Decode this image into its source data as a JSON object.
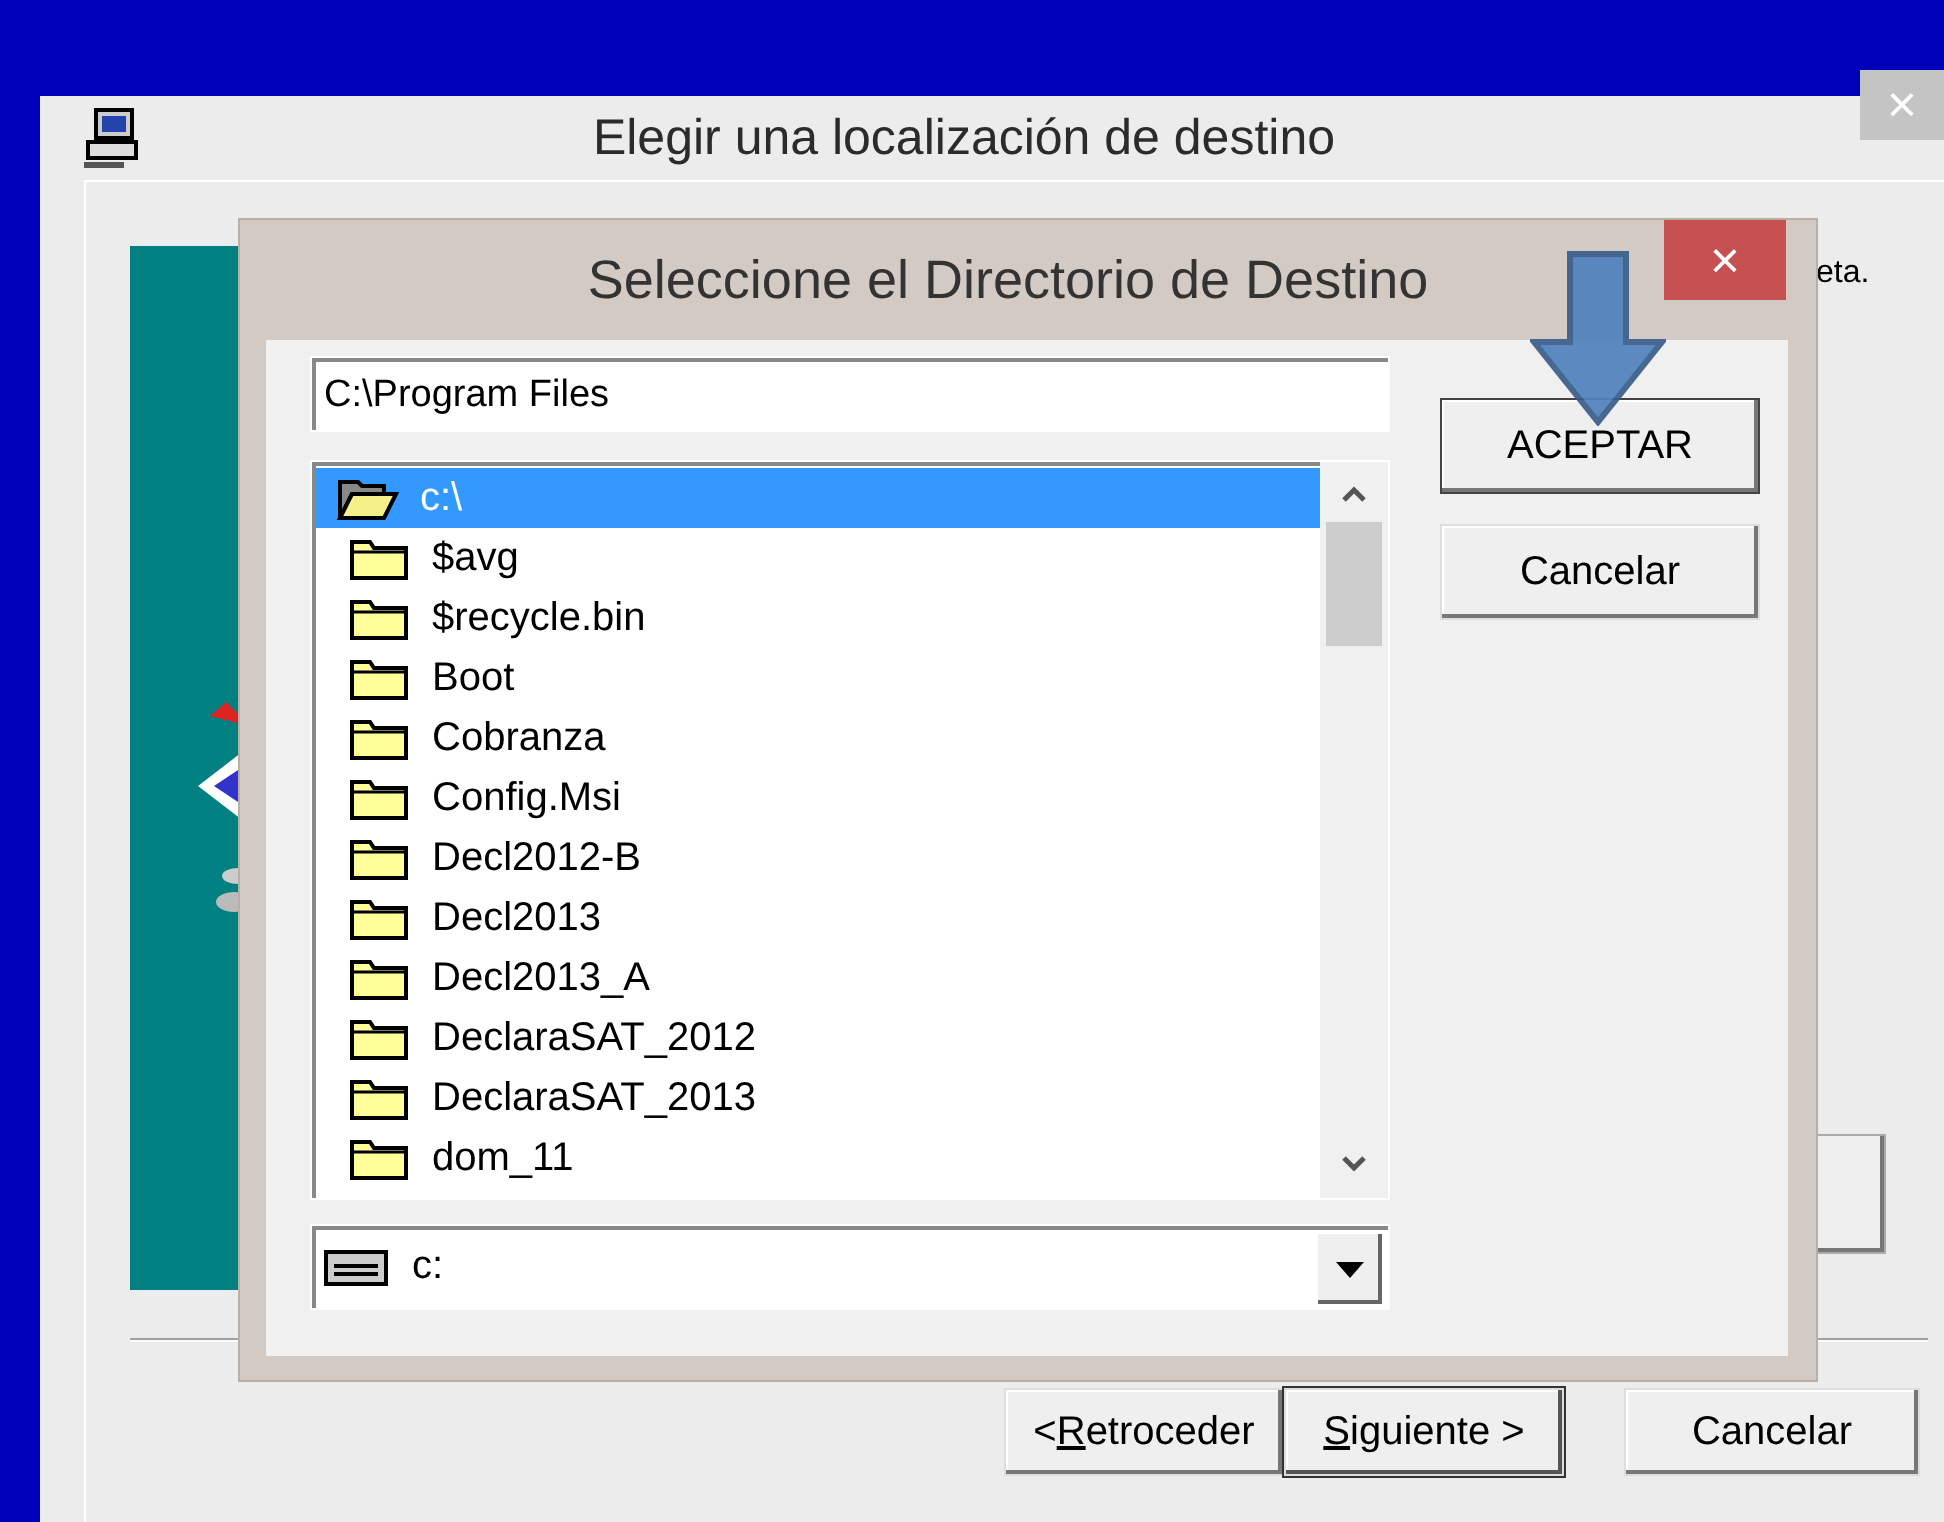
{
  "window": {
    "title": "Elegir una localización de destino",
    "close": "×",
    "partial_text": "eta."
  },
  "buttons": [
    {
      "prefix": "<",
      "key": "R",
      "rest": "etroceder",
      "default": false
    },
    {
      "key": "S",
      "rest": "iguiente >",
      "default": true
    },
    {
      "rest": "Cancelar",
      "default": false
    }
  ],
  "dialog": {
    "title": "Seleccione el Directorio de Destino",
    "close": "×",
    "path": "C:\\Program Files",
    "folders": [
      {
        "name": "c:\\",
        "selected": true,
        "open": true
      },
      {
        "name": "$avg",
        "selected": false,
        "open": false
      },
      {
        "name": "$recycle.bin",
        "selected": false,
        "open": false
      },
      {
        "name": "Boot",
        "selected": false,
        "open": false
      },
      {
        "name": "Cobranza",
        "selected": false,
        "open": false
      },
      {
        "name": "Config.Msi",
        "selected": false,
        "open": false
      },
      {
        "name": "Decl2012-B",
        "selected": false,
        "open": false
      },
      {
        "name": "Decl2013",
        "selected": false,
        "open": false
      },
      {
        "name": "Decl2013_A",
        "selected": false,
        "open": false
      },
      {
        "name": "DeclaraSAT_2012",
        "selected": false,
        "open": false
      },
      {
        "name": "DeclaraSAT_2013",
        "selected": false,
        "open": false
      },
      {
        "name": "dom_11",
        "selected": false,
        "open": false
      }
    ],
    "drive": "c:",
    "buttons": [
      "ACEPTAR",
      "Cancelar"
    ]
  }
}
